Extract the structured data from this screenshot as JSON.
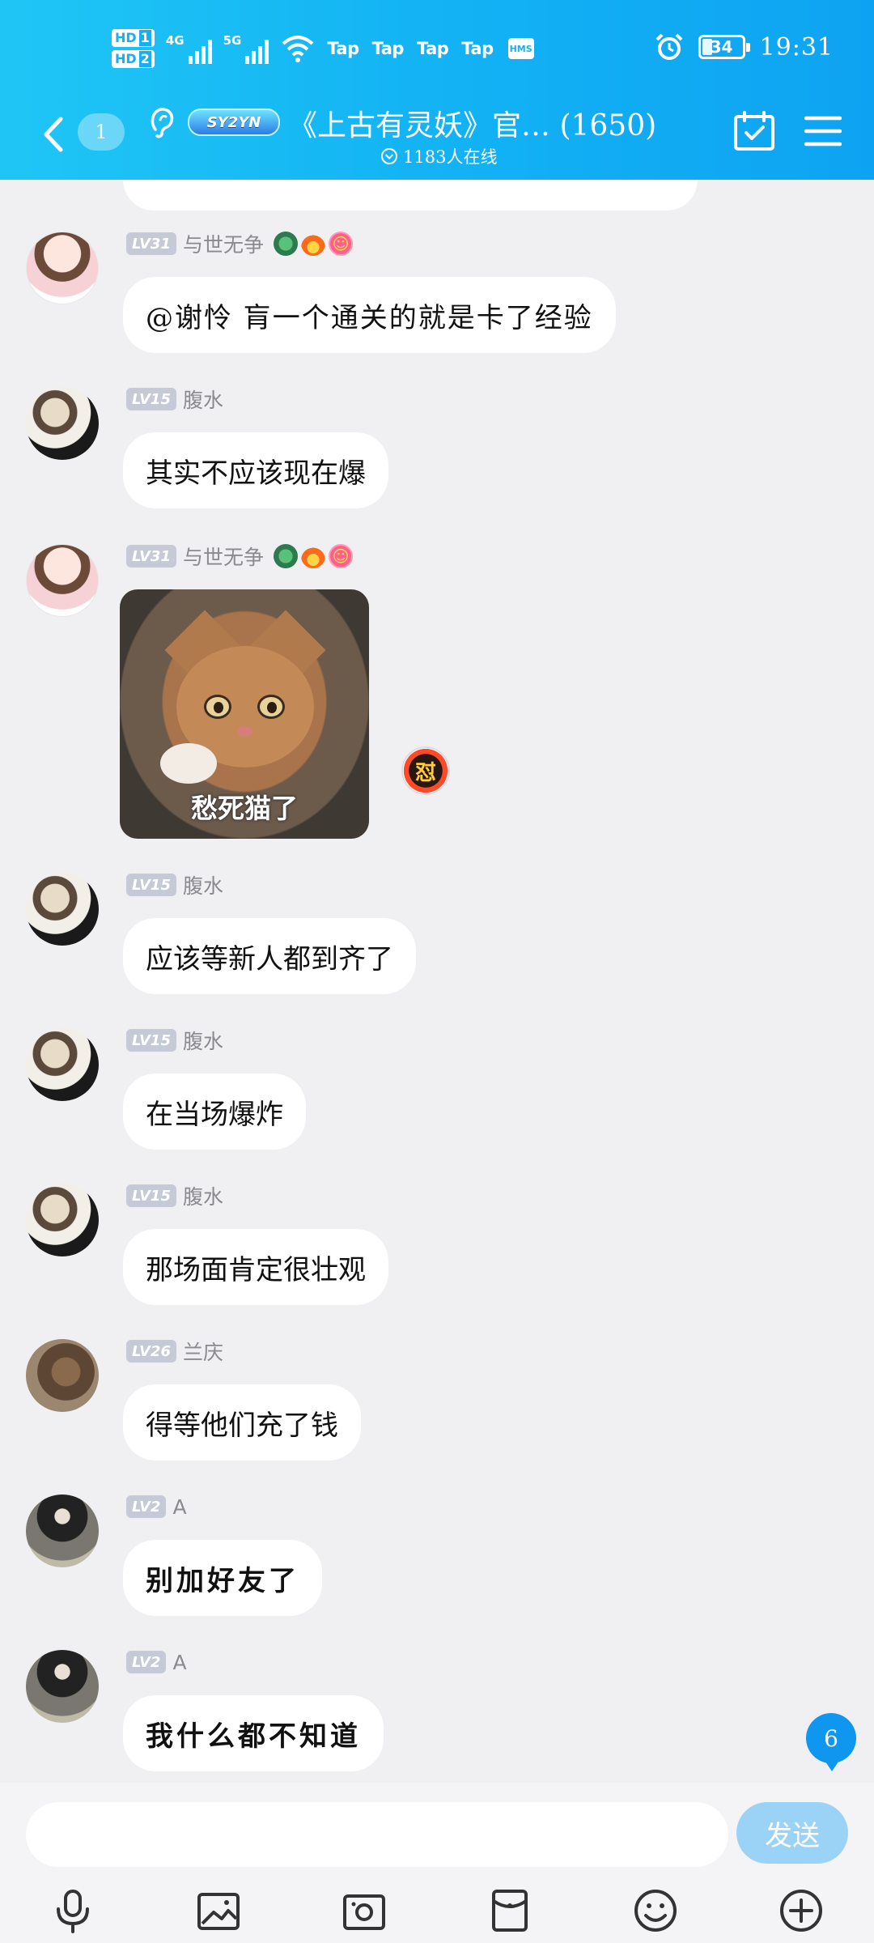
{
  "status_bar": {
    "hd1": "HD",
    "hd1_num": "1",
    "hd2": "HD",
    "hd2_num": "2",
    "net1": "4G",
    "net2": "5G",
    "tap_items": [
      "Tap",
      "Tap",
      "Tap",
      "Tap"
    ],
    "hms": "HMS",
    "battery": "34",
    "time": "19:31"
  },
  "header": {
    "unread_count": "1",
    "group_badge": "SY2YN",
    "title": "《上古有灵妖》官… (1650)",
    "online": "1183人在线"
  },
  "messages": [
    {
      "level": "LV31",
      "name": "与世无争",
      "text": "@谢怜 肓一个通关的就是卡了经验",
      "avatar": "anime-girl-avatar",
      "emblems": [
        "dragon-emblem",
        "fire-emblem",
        "smile-emblem"
      ]
    },
    {
      "level": "LV15",
      "name": "腹水",
      "text": "其实不应该现在爆",
      "avatar": "sketch-boy-avatar"
    },
    {
      "level": "LV31",
      "name": "与世无争",
      "sticker_caption": "愁死猫了",
      "react_glyph": "怼",
      "avatar": "anime-girl-avatar",
      "emblems": [
        "dragon-emblem",
        "fire-emblem",
        "smile-emblem"
      ]
    },
    {
      "level": "LV15",
      "name": "腹水",
      "text": "应该等新人都到齐了",
      "avatar": "sketch-boy-avatar"
    },
    {
      "level": "LV15",
      "name": "腹水",
      "text": "在当场爆炸",
      "avatar": "sketch-boy-avatar"
    },
    {
      "level": "LV15",
      "name": "腹水",
      "text": "那场面肯定很壮观",
      "avatar": "sketch-boy-avatar"
    },
    {
      "level": "LV26",
      "name": "兰庆",
      "text": "得等他们充了钱",
      "avatar": "photo-avatar"
    },
    {
      "level": "LV2",
      "name": "A",
      "text": "别加好友了",
      "avatar": "street-photo-avatar"
    },
    {
      "level": "LV2",
      "name": "A",
      "text": "我什么都不知道",
      "avatar": "street-photo-avatar"
    }
  ],
  "new_message_count": "6",
  "input": {
    "placeholder": "",
    "send_label": "发送"
  },
  "toolbar": [
    "mic-icon",
    "image-icon",
    "camera-icon",
    "red-packet-icon",
    "emoji-icon",
    "plus-icon"
  ],
  "colors": {
    "header_start": "#1fc6f5",
    "header_end": "#0ea3f2",
    "send": "#9bd3f7",
    "badge": "#0f96ee",
    "level_badge": "#c5cad6"
  }
}
